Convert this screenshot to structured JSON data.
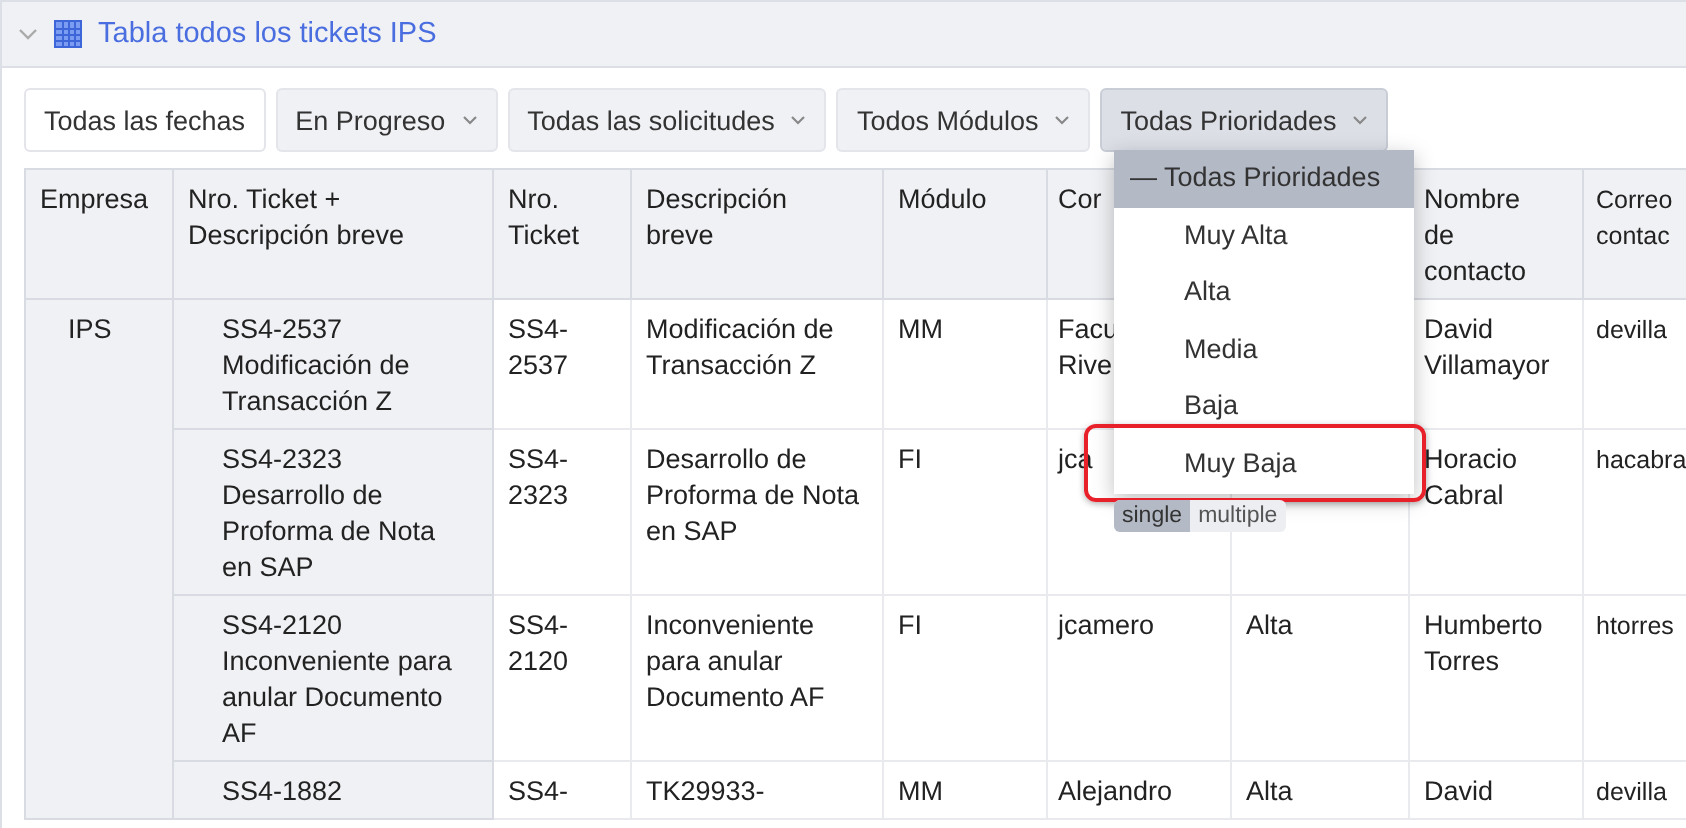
{
  "panel": {
    "title": "Tabla todos los tickets IPS",
    "expanded": true
  },
  "filters": [
    {
      "label": "Todas las fechas",
      "kind": "plain",
      "open": false
    },
    {
      "label": "En Progreso",
      "kind": "dropdown",
      "open": false
    },
    {
      "label": "Todas las solicitudes",
      "kind": "dropdown",
      "open": false
    },
    {
      "label": "Todos Módulos",
      "kind": "dropdown",
      "open": false
    },
    {
      "label": "Todas Prioridades",
      "kind": "dropdown",
      "open": true
    }
  ],
  "table": {
    "columns": [
      "Empresa",
      "Nro. Ticket + Descripción breve",
      "Nro. Ticket",
      "Descripción\nbreve",
      "Módulo",
      "Cor",
      null,
      "Nombre\nde\ncontacto",
      "Correo\ncontac"
    ],
    "rows": [
      {
        "cells": [
          {
            "text": "IPS",
            "rowspan": 4
          },
          "SS4-2537 Modificación de Transacción Z",
          "SS4-2537",
          "Modificación de Transacción Z",
          "MM",
          "Facu\nRive",
          null,
          "David Villamayor",
          "devilla"
        ]
      },
      {
        "cells": [
          "SS4-2323 Desarrollo de Proforma de Nota en SAP",
          "SS4-2323",
          "Desarrollo de Proforma de Nota en SAP",
          "FI",
          "jca",
          null,
          "Horacio Cabral",
          "hacabra"
        ]
      },
      {
        "cells": [
          "SS4-2120 Inconveniente para anular Documento AF",
          "SS4-2120",
          "Inconveniente para anular Documento AF",
          "FI",
          "jcamero",
          "Alta",
          "Humberto Torres",
          "htorres"
        ]
      },
      {
        "cells": [
          "SS4-1882",
          "SS4-",
          "TK29933-",
          "MM",
          "Alejandro",
          "Alta",
          "David",
          "devilla"
        ]
      }
    ]
  },
  "dropdown": {
    "items": [
      {
        "label": "— Todas Prioridades",
        "selected": true,
        "outlined": false
      },
      {
        "label": "Muy Alta",
        "selected": false,
        "outlined": false
      },
      {
        "label": "Alta",
        "selected": false,
        "outlined": false
      },
      {
        "label": "Media",
        "selected": false,
        "outlined": false
      },
      {
        "label": "Baja",
        "selected": false,
        "outlined": false
      },
      {
        "label": "Muy Baja",
        "selected": false,
        "outlined": true
      }
    ],
    "modes": [
      {
        "label": "single",
        "selected": true
      },
      {
        "label": "multiple",
        "selected": false
      }
    ]
  }
}
